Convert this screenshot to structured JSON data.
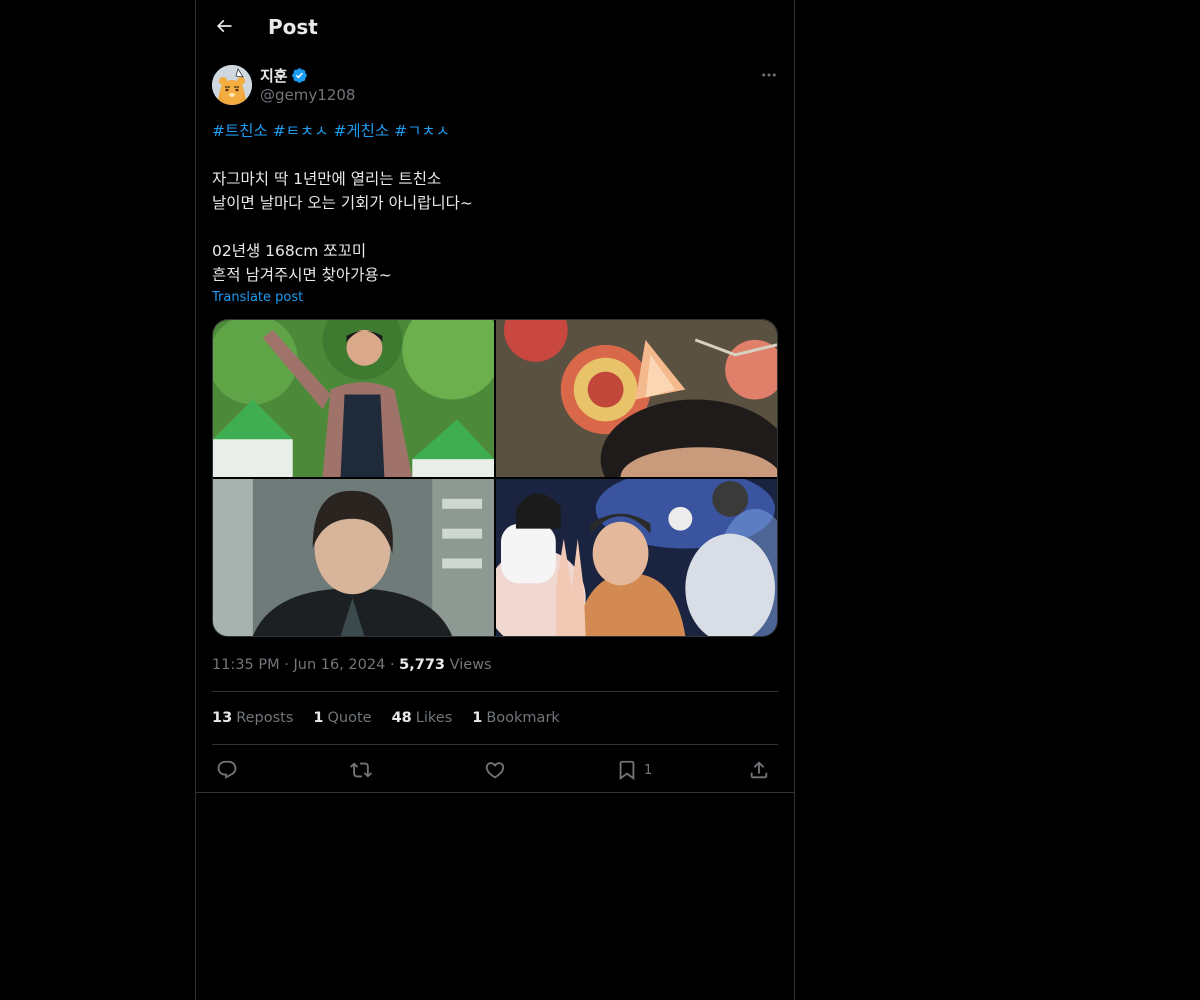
{
  "header": {
    "title": "Post",
    "back_icon": "arrow-left-icon"
  },
  "author": {
    "display_name": "지훈",
    "handle": "@gemy1208",
    "verified": true,
    "verified_color": "#1d9bf0"
  },
  "post": {
    "hashtags": [
      "#트친소",
      "#ㅌㅊㅅ",
      "#게친소",
      "#ㄱㅊㅅ"
    ],
    "lines": [
      "자그마치 딱 1년만에 열리는 트친소",
      "날이면 날마다 오는 기회가 아니랍니다~",
      "",
      "02년생 168cm 쪼꼬미",
      "흔적 남겨주시면 찾아가용~"
    ],
    "translate_label": "Translate post",
    "time": "11:35 PM",
    "separator": "·",
    "date": "Jun 16, 2024",
    "views_count": "5,773",
    "views_label": "Views"
  },
  "stats": [
    {
      "count": "13",
      "label": "Reposts"
    },
    {
      "count": "1",
      "label": "Quote"
    },
    {
      "count": "48",
      "label": "Likes"
    },
    {
      "count": "1",
      "label": "Bookmark"
    }
  ],
  "actions": {
    "reply_icon": "reply-icon",
    "repost_icon": "repost-icon",
    "like_icon": "heart-icon",
    "bookmark_icon": "bookmark-icon",
    "bookmark_count": "1",
    "share_icon": "share-icon"
  },
  "colors": {
    "background": "#000000",
    "text": "#e7e9ea",
    "muted": "#71767b",
    "accent": "#1d9bf0",
    "border": "#2f3336"
  }
}
